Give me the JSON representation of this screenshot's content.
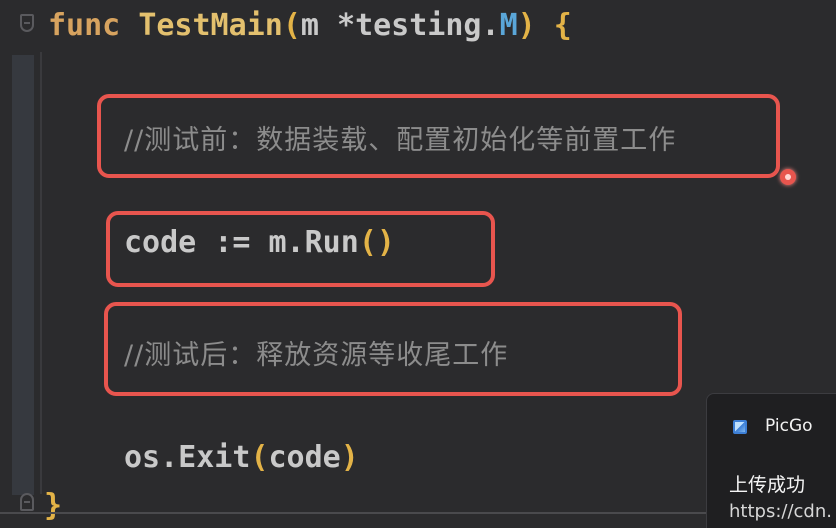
{
  "editor": {
    "line1": {
      "keyword": "func",
      "function_name": "TestMain",
      "open_paren": "(",
      "param": "m",
      "star": "*",
      "pkg": "testing.",
      "type": "M",
      "close": ")",
      "brace": "{"
    },
    "comment_before": "//测试前：数据装载、配置初始化等前置工作",
    "run_line": {
      "var": "code",
      "op": ":=",
      "call": "m.Run",
      "parens": "()"
    },
    "comment_after": "//测试后：释放资源等收尾工作",
    "exit_line": {
      "call": "os.Exit",
      "open": "(",
      "arg": "code",
      "close": ")"
    },
    "closing_brace": "}"
  },
  "notification": {
    "app_name": "PicGo",
    "title": "上传成功",
    "body": "https://cdn."
  },
  "colors": {
    "highlight_box": "#e8554e",
    "background": "#2b2b2d",
    "keyword": "#d7a35f",
    "type": "#5aa6d8"
  }
}
